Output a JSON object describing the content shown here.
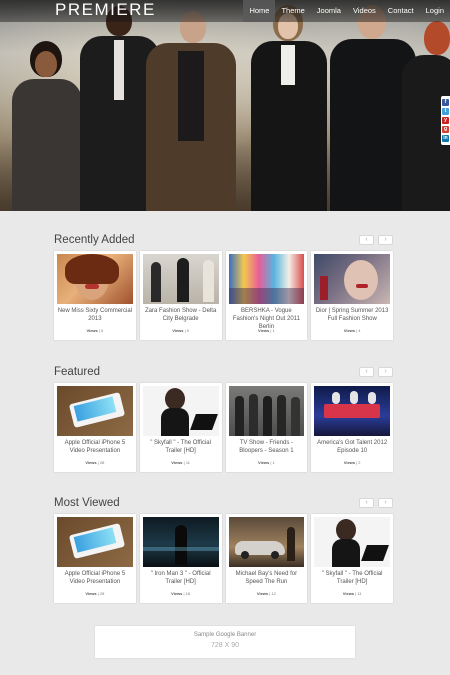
{
  "header": {
    "logo": "PREMIERE",
    "nav": [
      {
        "label": "Home",
        "active": true
      },
      {
        "label": "Theme",
        "active": false
      },
      {
        "label": "Joomla",
        "active": false
      },
      {
        "label": "Videos",
        "active": false
      },
      {
        "label": "Contact",
        "active": false
      },
      {
        "label": "Login",
        "active": false
      }
    ]
  },
  "share_icons": [
    {
      "icon": "facebook-icon",
      "color": "#3b5998",
      "glyph": "f"
    },
    {
      "icon": "twitter-icon",
      "color": "#41a0d9",
      "glyph": "t"
    },
    {
      "icon": "youtube-icon",
      "color": "#cc2222",
      "glyph": "y"
    },
    {
      "icon": "google-icon",
      "color": "#d44132",
      "glyph": "g"
    },
    {
      "icon": "linkedin-icon",
      "color": "#0e76a8",
      "glyph": "in"
    }
  ],
  "sections": [
    {
      "title": "Recently Added",
      "prev": "‹",
      "next": "›",
      "items": [
        {
          "title": "New Miss Sixty Commercial 2013",
          "views_label": "Views",
          "views": "0"
        },
        {
          "title": "Zara Fashion Show - Delta City Belgrade",
          "views_label": "Views",
          "views": "0"
        },
        {
          "title": "BERSHKA - Vogue Fashion's Night Out 2011 Berlin",
          "views_label": "Views",
          "views": "1"
        },
        {
          "title": "Dior | Spring Summer 2013 Full Fashion Show",
          "views_label": "Views",
          "views": "4"
        }
      ]
    },
    {
      "title": "Featured",
      "prev": "‹",
      "next": "›",
      "items": [
        {
          "title": "Apple Official iPhone 5 Video Presentation",
          "views_label": "Views",
          "views": "28"
        },
        {
          "title": "\" Skyfall \" - The Official Trailer [HD]",
          "views_label": "Views",
          "views": "11"
        },
        {
          "title": "TV Show - Friends - Bloopers - Season 1",
          "views_label": "Views",
          "views": "1"
        },
        {
          "title": "America's Got Talent 2012 Episode 10",
          "views_label": "Views",
          "views": "2"
        }
      ]
    },
    {
      "title": "Most Viewed",
      "prev": "‹",
      "next": "›",
      "items": [
        {
          "title": "Apple Official iPhone 5 Video Presentation",
          "views_label": "Views",
          "views": "28"
        },
        {
          "title": "\" Iron Man 3 \" - Official Trailer [HD]",
          "views_label": "Views",
          "views": "16"
        },
        {
          "title": "Michael Bay's Need for Speed The Run",
          "views_label": "Views",
          "views": "12"
        },
        {
          "title": "\" Skyfall \" - The Official Trailer [HD]",
          "views_label": "Views",
          "views": "11"
        }
      ]
    }
  ],
  "banner": {
    "line1": "Sample Google Banner",
    "line2": "728 X 90"
  }
}
